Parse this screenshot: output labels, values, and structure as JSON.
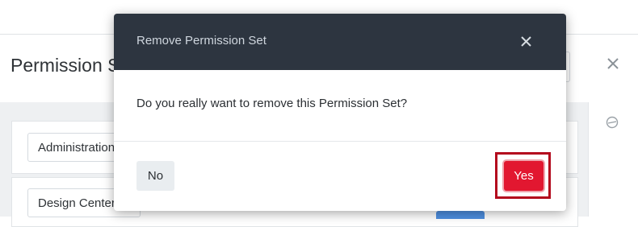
{
  "page": {
    "title": "Permission S",
    "fields": [
      {
        "value": "Administration"
      },
      {
        "value": "Design Center"
      }
    ]
  },
  "dialog": {
    "title": "Remove Permission Set",
    "message": "Do you really want to remove this Permission Set?",
    "no_label": "No",
    "yes_label": "Yes",
    "close_icon": "close-icon"
  },
  "icons": {
    "panel_close": "close-icon",
    "side": "history-icon"
  },
  "colors": {
    "dialog_header": "#2d3540",
    "yes_button": "#e21730",
    "highlight": "#b3091d",
    "no_button": "#e9edf0"
  }
}
